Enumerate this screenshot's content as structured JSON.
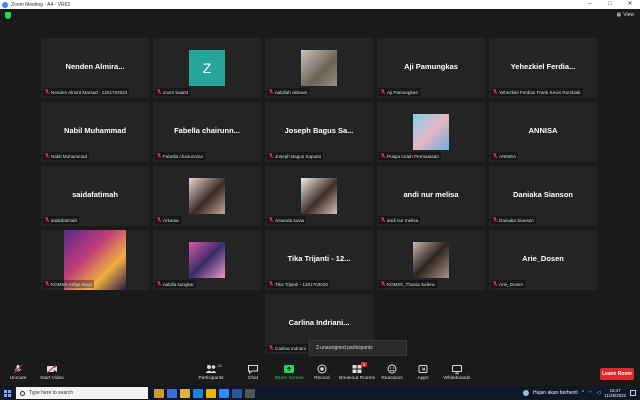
{
  "window": {
    "title": "Zoom Meeting - A4 - VR63",
    "view_label": "View"
  },
  "tiles": [
    {
      "kind": "name",
      "display": "Nenden  Almira...",
      "label": "Nenden Almira Marsad - 1201703022"
    },
    {
      "kind": "letter",
      "display": "Z",
      "label": "zoom baa04"
    },
    {
      "kind": "photo",
      "label": "nabillah wibowo"
    },
    {
      "kind": "name",
      "display": "Aji Pamungkas",
      "label": "Aji Pamungkas"
    },
    {
      "kind": "name",
      "display": "Yehezkiel  Ferdia...",
      "label": "Yehezkiel Ferdian Frank Kevin Rumbiak"
    },
    {
      "kind": "name",
      "display": "Nabil Muhammad",
      "label": "Nabil Muhammad"
    },
    {
      "kind": "name",
      "display": "Fabella  chairunn...",
      "label": "Fabella chairunniza"
    },
    {
      "kind": "name",
      "display": "Joseph Bagus Sa...",
      "label": "Joseph Bagus Saputra"
    },
    {
      "kind": "photo",
      "label": "Puspa Indah Permatasari"
    },
    {
      "kind": "name",
      "display": "ANNISA",
      "label": "ANNISA"
    },
    {
      "kind": "name",
      "display": "saidafatimah",
      "label": "saidafatimah"
    },
    {
      "kind": "photo",
      "label": "Arkania"
    },
    {
      "kind": "photo",
      "label": "Amanda sovia"
    },
    {
      "kind": "name",
      "display": "andi nur melisa",
      "label": "andi nur melisa"
    },
    {
      "kind": "name",
      "display": "Daniaka Sianson",
      "label": "Daniaka Sianson"
    },
    {
      "kind": "photo",
      "label": "KOM5X-Arifga Bayu"
    },
    {
      "kind": "photo",
      "label": "nabilla sungkar"
    },
    {
      "kind": "name",
      "display": "Tika Trijanti  - 12...",
      "label": "Tika Trijanti - 1201703020"
    },
    {
      "kind": "photo",
      "label": "KOM2X_Thania Safera"
    },
    {
      "kind": "name",
      "display": "Arie_Dosen",
      "label": "Arie_Dosen"
    },
    {
      "kind": "name",
      "display": "Carlina  Indriani...",
      "label": "Carlina Indriani"
    }
  ],
  "toast": "3 unassigned participants",
  "toolbar": {
    "unmute": "Unmute",
    "start_video": "Start Video",
    "participants": "Participants",
    "participants_count": "21",
    "chat": "Chat",
    "share_screen": "Share Screen",
    "record": "Record",
    "breakout_rooms": "Breakout Rooms",
    "breakout_badge": "3",
    "reactions": "Reactions",
    "apps": "Apps",
    "whiteboards": "Whiteboards",
    "leave": "Leave Room"
  },
  "taskbar": {
    "search_placeholder": "Type here to search",
    "weather": "Hujan akan berhenti",
    "time": "18:47",
    "date": "11/28/2022"
  },
  "colors": {
    "accent_green": "#23d959",
    "leave_red": "#e02828",
    "zoom_blue": "#2d8cff",
    "avatar_teal": "#26a69a"
  }
}
